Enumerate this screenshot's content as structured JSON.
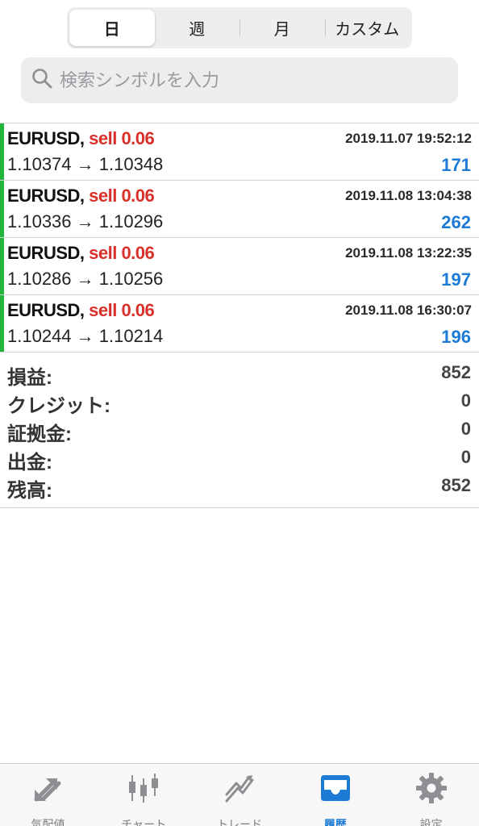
{
  "period_tabs": [
    {
      "label": "日",
      "active": true
    },
    {
      "label": "週",
      "active": false
    },
    {
      "label": "月",
      "active": false
    },
    {
      "label": "カスタム",
      "active": false
    }
  ],
  "search": {
    "placeholder": "検索シンボルを入力",
    "value": ""
  },
  "trades": [
    {
      "symbol": "EURUSD,",
      "side": "sell 0.06",
      "time": "2019.11.07 19:52:12",
      "prices": "1.10374 → 1.10348",
      "profit": "171"
    },
    {
      "symbol": "EURUSD,",
      "side": "sell 0.06",
      "time": "2019.11.08 13:04:38",
      "prices": "1.10336 → 1.10296",
      "profit": "262"
    },
    {
      "symbol": "EURUSD,",
      "side": "sell 0.06",
      "time": "2019.11.08 13:22:35",
      "prices": "1.10286 → 1.10256",
      "profit": "197"
    },
    {
      "symbol": "EURUSD,",
      "side": "sell 0.06",
      "time": "2019.11.08 16:30:07",
      "prices": "1.10244 → 1.10214",
      "profit": "196"
    }
  ],
  "summary": [
    {
      "label": "損益:",
      "value": "852"
    },
    {
      "label": "クレジット:",
      "value": "0"
    },
    {
      "label": "証拠金:",
      "value": "0"
    },
    {
      "label": "出金:",
      "value": "0"
    },
    {
      "label": "残高:",
      "value": "852"
    }
  ],
  "tabbar": [
    {
      "label": "気配値",
      "icon": "quotes-arrows-icon",
      "active": false
    },
    {
      "label": "チャート",
      "icon": "candlestick-chart-icon",
      "active": false
    },
    {
      "label": "トレード",
      "icon": "trade-trend-icon",
      "active": false
    },
    {
      "label": "履歴",
      "icon": "history-tray-icon",
      "active": true
    },
    {
      "label": "設定",
      "icon": "gear-icon",
      "active": false
    }
  ],
  "colors": {
    "buy_bar": "#21b33b",
    "sell_text": "#d9302a",
    "profit_text": "#1d7bd6",
    "active_tab": "#1d7bd6",
    "inactive_tab": "#8e8e93"
  }
}
